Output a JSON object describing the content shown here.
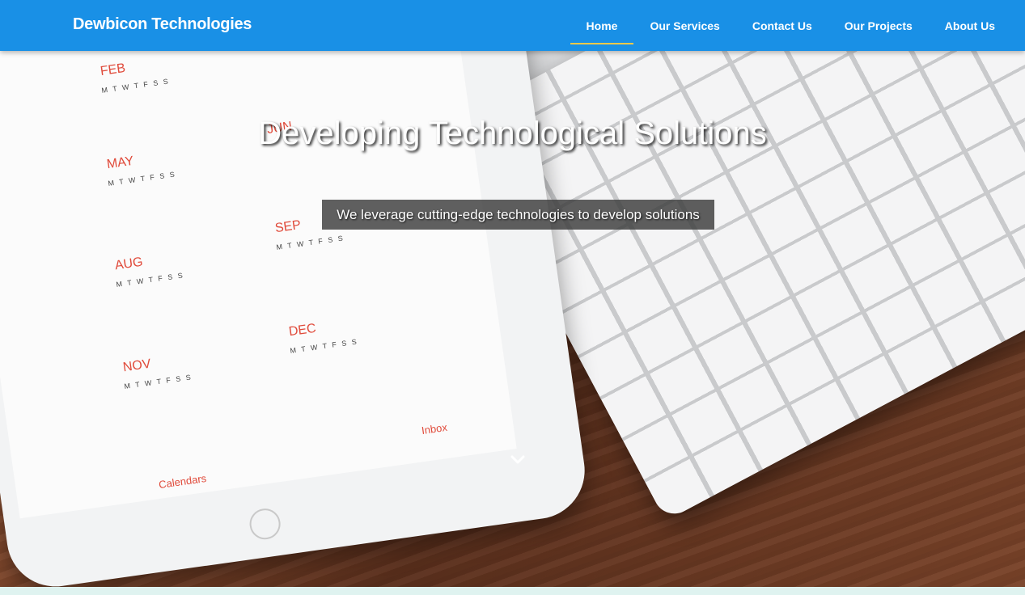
{
  "brand": {
    "name": "Dewbicon Technologies"
  },
  "nav": {
    "items": [
      {
        "label": "Home",
        "active": true
      },
      {
        "label": "Our Services",
        "active": false
      },
      {
        "label": "Contact Us",
        "active": false
      },
      {
        "label": "Our Projects",
        "active": false
      },
      {
        "label": "About Us",
        "active": false
      }
    ]
  },
  "hero": {
    "title": "Developing Technological Solutions",
    "subtitle": "We leverage cutting-edge technologies to develop solutions",
    "scroll_icon": "chevron-down-icon"
  },
  "calendar": {
    "months": [
      "FEB",
      "MAY",
      "AUG",
      "NOV",
      "SEP",
      "DEC",
      "JUN"
    ],
    "weekdays": "M T W T F S S",
    "labels": {
      "calendars": "Calendars",
      "inbox": "Inbox"
    }
  },
  "colors": {
    "navbar": "#1990e6",
    "active_underline": "#f3c94a",
    "accent_red": "#e04a3a"
  }
}
